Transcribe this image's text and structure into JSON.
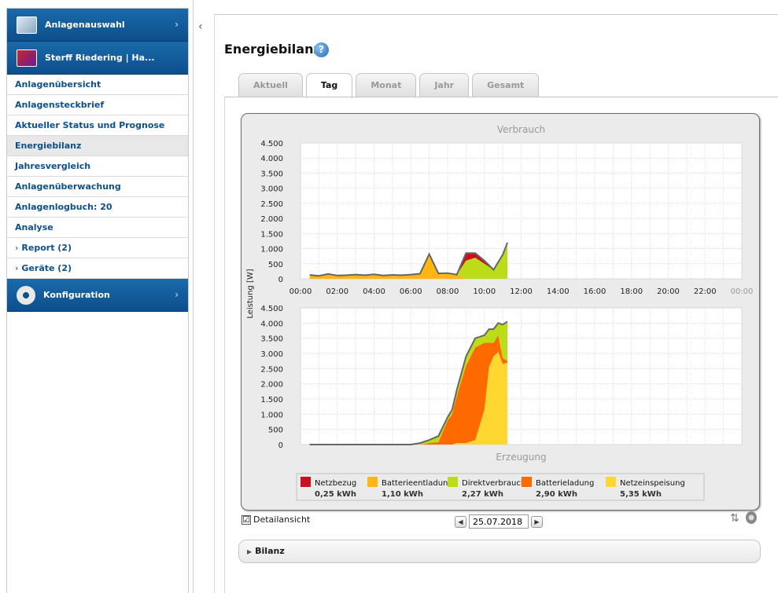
{
  "sidebar": {
    "anlagenauswahl": "Anlagenauswahl",
    "plant": "Sterff Riedering | Ha...",
    "items": [
      {
        "label": "Anlagenübersicht"
      },
      {
        "label": "Anlagensteckbrief"
      },
      {
        "label": "Aktueller Status und Prognose"
      },
      {
        "label": "Energiebilanz"
      },
      {
        "label": "Jahresvergleich"
      },
      {
        "label": "Anlagenüberwachung"
      },
      {
        "label": "Anlagenlogbuch: 20"
      },
      {
        "label": "Analyse"
      },
      {
        "label": "Report (2)"
      },
      {
        "label": "Geräte (2)"
      }
    ],
    "konfiguration": "Konfiguration"
  },
  "main": {
    "title": "Energiebilanz",
    "help": "?",
    "tabs": [
      "Aktuell",
      "Tag",
      "Monat",
      "Jahr",
      "Gesamt"
    ],
    "active_tab": "Tag",
    "detail_label": "Detailansicht",
    "detail_checked": "☑",
    "date": "25.07.2018",
    "bilanz_label": "Bilanz"
  },
  "colors": {
    "netzbezug": "#c8101e",
    "batterieentladung": "#ffb612",
    "direktverbrauch": "#bddc18",
    "batterieladung": "#ff6a00",
    "netzeinspeisung": "#ffd730",
    "line": "#666666"
  },
  "chart_data": [
    {
      "type": "area",
      "title": "Verbrauch",
      "ylabel": "Leistung [W]",
      "ylim": [
        0,
        4500
      ],
      "yticks": [
        "4.500",
        "4.000",
        "3.500",
        "3.000",
        "2.500",
        "2.000",
        "1.500",
        "1.000",
        "500",
        "0"
      ],
      "xticks": [
        "00:00",
        "02:00",
        "04:00",
        "06:00",
        "08:00",
        "10:00",
        "12:00",
        "14:00",
        "16:00",
        "18:00",
        "20:00",
        "22:00",
        "00:00"
      ],
      "x_hours": [
        0.5,
        1,
        1.5,
        2,
        2.5,
        3,
        3.5,
        4,
        4.5,
        5,
        5.5,
        6,
        6.5,
        7,
        7.5,
        8,
        8.5,
        9,
        9.5,
        10,
        10.5,
        11,
        11.25
      ],
      "series": [
        {
          "name": "Batterieentladung",
          "values": [
            130,
            100,
            160,
            110,
            120,
            140,
            120,
            150,
            110,
            130,
            120,
            140,
            170,
            820,
            180,
            190,
            140,
            0,
            0,
            0,
            0,
            0,
            0
          ]
        },
        {
          "name": "Direktverbrauch",
          "values": [
            0,
            0,
            0,
            0,
            0,
            0,
            0,
            0,
            0,
            0,
            0,
            0,
            0,
            0,
            0,
            0,
            0,
            600,
            700,
            500,
            300,
            800,
            1200
          ]
        },
        {
          "name": "Netzbezug",
          "values": [
            0,
            0,
            0,
            0,
            0,
            0,
            0,
            0,
            0,
            0,
            0,
            0,
            0,
            0,
            0,
            0,
            0,
            250,
            150,
            100,
            0,
            0,
            0
          ]
        }
      ]
    },
    {
      "type": "area",
      "title": "Erzeugung",
      "ylabel": "Leistung [W]",
      "ylim": [
        0,
        4500
      ],
      "yticks": [
        "4.500",
        "4.000",
        "3.500",
        "3.000",
        "2.500",
        "2.000",
        "1.500",
        "1.000",
        "500",
        "0"
      ],
      "x_hours": [
        0.5,
        1,
        2,
        3,
        4,
        5,
        6,
        6.5,
        7,
        7.5,
        8,
        8.25,
        8.5,
        9,
        9.5,
        10,
        10.25,
        10.5,
        10.75,
        11,
        11.25
      ],
      "series": [
        {
          "name": "Netzeinspeisung",
          "values": [
            0,
            0,
            0,
            0,
            0,
            0,
            0,
            0,
            0,
            0,
            0,
            0,
            50,
            50,
            150,
            1150,
            2550,
            2900,
            3050,
            2650,
            2700
          ]
        },
        {
          "name": "Batterieladung",
          "values": [
            0,
            0,
            0,
            0,
            0,
            0,
            0,
            0,
            50,
            80,
            800,
            1000,
            1550,
            2550,
            3050,
            2200,
            800,
            450,
            550,
            200,
            50
          ]
        },
        {
          "name": "Direktverbrauch",
          "values": [
            0,
            0,
            0,
            0,
            0,
            0,
            0,
            50,
            100,
            200,
            100,
            150,
            200,
            300,
            300,
            250,
            450,
            450,
            400,
            1100,
            1300
          ]
        }
      ]
    }
  ],
  "legend": [
    {
      "name": "Netzbezug",
      "value": "0,25 kWh",
      "color": "#c8101e"
    },
    {
      "name": "Batterieentladung",
      "value": "1,10 kWh",
      "color": "#ffb612"
    },
    {
      "name": "Direktverbrauch",
      "value": "2,27 kWh",
      "color": "#bddc18"
    },
    {
      "name": "Batterieladung",
      "value": "2,90 kWh",
      "color": "#ff6a00"
    },
    {
      "name": "Netzeinspeisung",
      "value": "5,35 kWh",
      "color": "#ffd730"
    }
  ]
}
